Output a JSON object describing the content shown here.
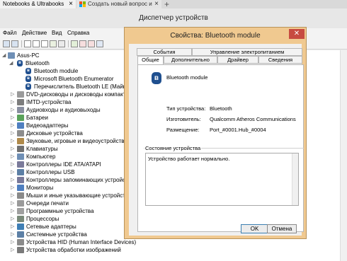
{
  "browser": {
    "tab1_label": "Notebooks & Ultrabooks",
    "tab2_label": "Создать новый вопрос и",
    "close_glyph": "×",
    "new_tab_glyph": "+"
  },
  "device_manager": {
    "title": "Диспетчер устройств",
    "menu": [
      "Файл",
      "Действие",
      "Вид",
      "Справка"
    ],
    "tree": [
      {
        "label": "Asus-PC",
        "expanded": true
      },
      {
        "label": "Bluetooth",
        "expanded": true
      },
      {
        "label": "Bluetooth module"
      },
      {
        "label": "Microsoft Bluetooth Enumerator"
      },
      {
        "label": "Перечислитель Bluetooth LE (Майкро"
      },
      {
        "label": "DVD-дисководы и дисководы компакт-д"
      },
      {
        "label": "IMTD-устройства"
      },
      {
        "label": "Аудиовходы и аудиовыходы"
      },
      {
        "label": "Батареи"
      },
      {
        "label": "Видеоадаптеры"
      },
      {
        "label": "Дисковые устройства"
      },
      {
        "label": "Звуковые, игровые и видеоустройства"
      },
      {
        "label": "Клавиатуры"
      },
      {
        "label": "Компьютер"
      },
      {
        "label": "Контроллеры IDE ATA/ATAPI"
      },
      {
        "label": "Контроллеры USB"
      },
      {
        "label": "Контроллеры запоминающих устройств"
      },
      {
        "label": "Мониторы"
      },
      {
        "label": "Мыши и иные указывающие устройства"
      },
      {
        "label": "Очереди печати"
      },
      {
        "label": "Программные устройства"
      },
      {
        "label": "Процессоры"
      },
      {
        "label": "Сетевые адаптеры"
      },
      {
        "label": "Системные устройства"
      },
      {
        "label": "Устройства HID (Human Interface Devices)"
      },
      {
        "label": "Устройства обработки изображений"
      }
    ]
  },
  "dialog": {
    "title": "Свойства: Bluetooth module",
    "close_glyph": "✕",
    "tabs_top": [
      "События",
      "Управление электропитанием"
    ],
    "tabs_bottom": [
      "Общие",
      "Дополнительно",
      "Драйвер",
      "Сведения"
    ],
    "device_name": "Bluetooth module",
    "properties": [
      {
        "label": "Тип устройства:",
        "value": "Bluetooth"
      },
      {
        "label": "Изготовитель:",
        "value": "Qualcomm Atheros Communications"
      },
      {
        "label": "Размещение:",
        "value": "Port_#0001.Hub_#0004"
      }
    ],
    "status_group_label": "Состояние устройства",
    "status_text": "Устройство работает нормально.",
    "ok_label": "OK",
    "cancel_label": "Отмена"
  },
  "colors": {
    "dialog_frame": "#f0c990",
    "close_button": "#c74b41",
    "bluetooth_icon": "#1f4f8f"
  }
}
